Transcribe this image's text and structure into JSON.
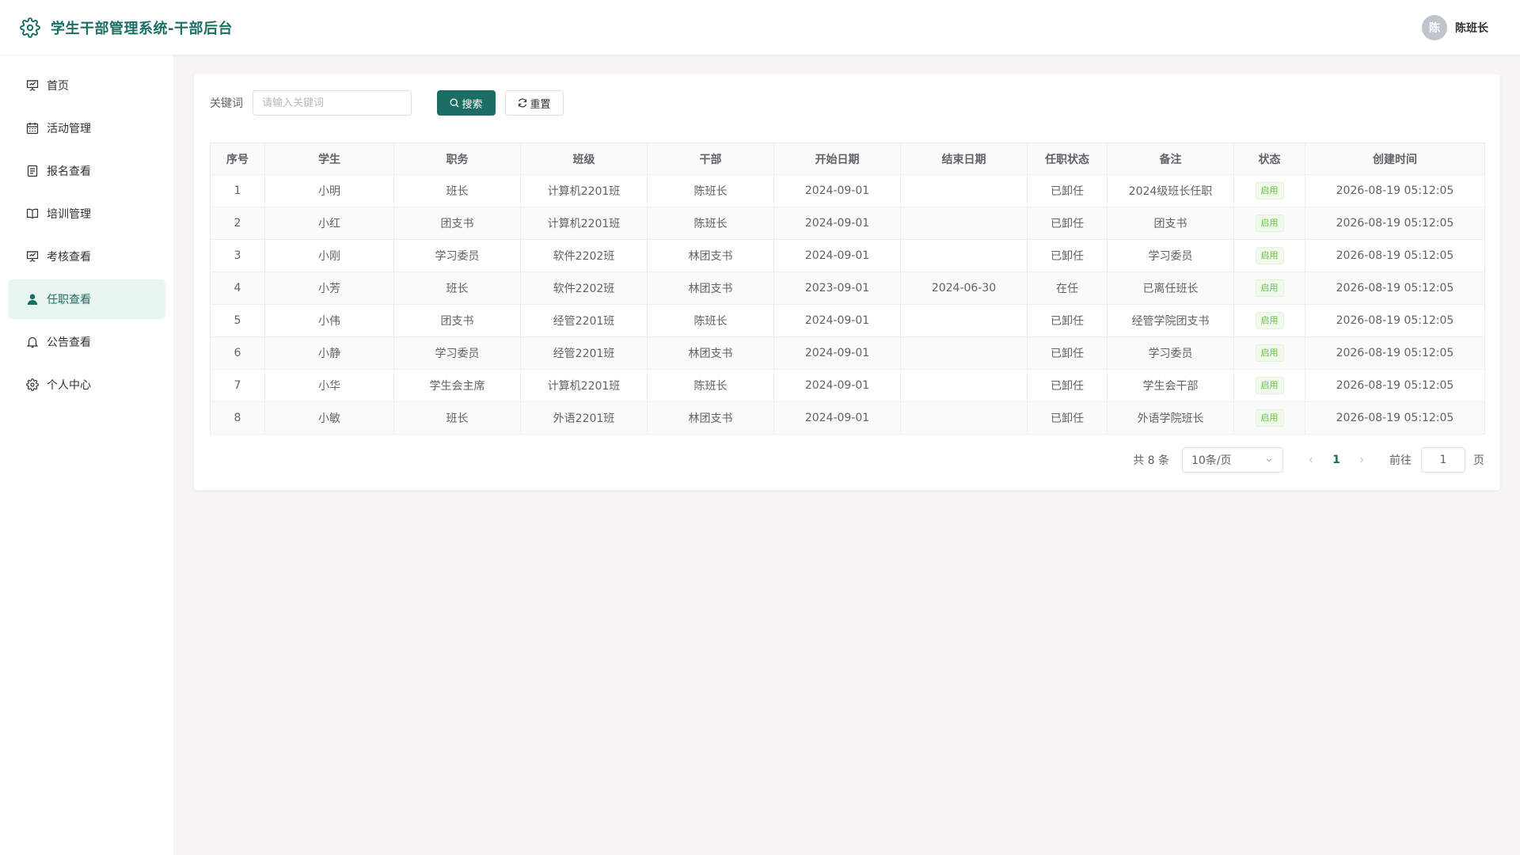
{
  "header": {
    "title": "学生干部管理系统-干部后台",
    "user": {
      "avatar_text": "陈",
      "name": "陈班长"
    }
  },
  "sidebar": {
    "items": [
      {
        "label": "首页",
        "icon": "presentation-icon"
      },
      {
        "label": "活动管理",
        "icon": "calendar-icon"
      },
      {
        "label": "报名查看",
        "icon": "document-icon"
      },
      {
        "label": "培训管理",
        "icon": "book-icon"
      },
      {
        "label": "考核查看",
        "icon": "presentation-icon"
      },
      {
        "label": "任职查看",
        "icon": "user-icon",
        "active": true
      },
      {
        "label": "公告查看",
        "icon": "bell-icon"
      },
      {
        "label": "个人中心",
        "icon": "gear-icon"
      }
    ]
  },
  "search": {
    "label": "关键词",
    "placeholder": "请输入关键词",
    "value": "",
    "search_button": "搜索",
    "reset_button": "重置"
  },
  "table": {
    "columns": [
      "序号",
      "学生",
      "职务",
      "班级",
      "干部",
      "开始日期",
      "结束日期",
      "任职状态",
      "备注",
      "状态",
      "创建时间"
    ],
    "rows": [
      [
        "1",
        "小明",
        "班长",
        "计算机2201班",
        "陈班长",
        "2024-09-01",
        "",
        "已卸任",
        "2024级班长任职",
        "启用",
        "2026-08-19 05:12:05"
      ],
      [
        "2",
        "小红",
        "团支书",
        "计算机2201班",
        "陈班长",
        "2024-09-01",
        "",
        "已卸任",
        "团支书",
        "启用",
        "2026-08-19 05:12:05"
      ],
      [
        "3",
        "小刚",
        "学习委员",
        "软件2202班",
        "林团支书",
        "2024-09-01",
        "",
        "已卸任",
        "学习委员",
        "启用",
        "2026-08-19 05:12:05"
      ],
      [
        "4",
        "小芳",
        "班长",
        "软件2202班",
        "林团支书",
        "2023-09-01",
        "2024-06-30",
        "在任",
        "已离任班长",
        "启用",
        "2026-08-19 05:12:05"
      ],
      [
        "5",
        "小伟",
        "团支书",
        "经管2201班",
        "陈班长",
        "2024-09-01",
        "",
        "已卸任",
        "经管学院团支书",
        "启用",
        "2026-08-19 05:12:05"
      ],
      [
        "6",
        "小静",
        "学习委员",
        "经管2201班",
        "林团支书",
        "2024-09-01",
        "",
        "已卸任",
        "学习委员",
        "启用",
        "2026-08-19 05:12:05"
      ],
      [
        "7",
        "小华",
        "学生会主席",
        "计算机2201班",
        "陈班长",
        "2024-09-01",
        "",
        "已卸任",
        "学生会干部",
        "启用",
        "2026-08-19 05:12:05"
      ],
      [
        "8",
        "小敏",
        "班长",
        "外语2201班",
        "林团支书",
        "2024-09-01",
        "",
        "已卸任",
        "外语学院班长",
        "启用",
        "2026-08-19 05:12:05"
      ]
    ]
  },
  "pagination": {
    "total_text": "共 8 条",
    "page_size": "10条/页",
    "current_page": "1",
    "goto_label": "前往",
    "goto_value": "1",
    "page_unit": "页"
  },
  "colors": {
    "primary": "#1b6e64",
    "active_bg": "#e8f5f1",
    "tag_green": "#67c23a"
  }
}
